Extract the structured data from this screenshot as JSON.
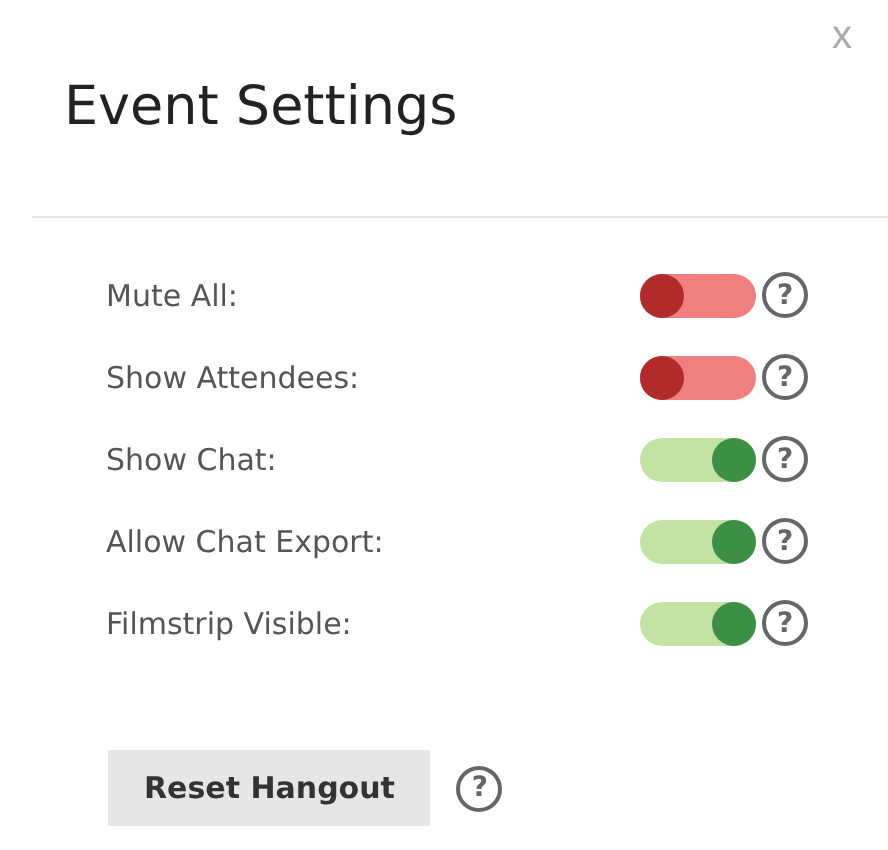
{
  "close": "x",
  "title": "Event Settings",
  "settings": [
    {
      "label": "Mute All:",
      "on": false,
      "help": "?"
    },
    {
      "label": "Show Attendees:",
      "on": false,
      "help": "?"
    },
    {
      "label": "Show Chat:",
      "on": true,
      "help": "?"
    },
    {
      "label": "Allow Chat Export:",
      "on": true,
      "help": "?"
    },
    {
      "label": "Filmstrip Visible:",
      "on": true,
      "help": "?"
    }
  ],
  "button": {
    "label": "Reset Hangout",
    "help": "?"
  }
}
